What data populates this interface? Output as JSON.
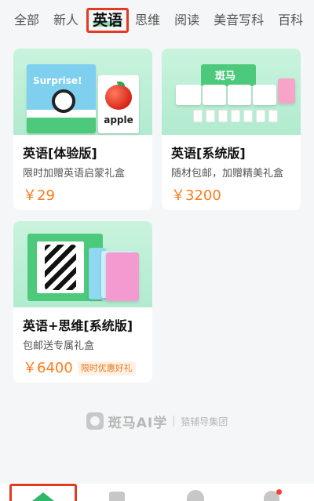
{
  "tabs": [
    {
      "label": "全部"
    },
    {
      "label": "新人"
    },
    {
      "label": "英语",
      "active": true
    },
    {
      "label": "思维"
    },
    {
      "label": "阅读"
    },
    {
      "label": "美音写科"
    },
    {
      "label": "百科"
    }
  ],
  "products": [
    {
      "title": "英语[体验版]",
      "desc": "限时加赠英语启蒙礼盒",
      "price": "￥29",
      "thumb": {
        "book_text": "Surprise!",
        "card_word": "apple"
      }
    },
    {
      "title": "英语[系统版]",
      "desc": "随材包邮，加赠精美礼盒",
      "price": "￥3200",
      "thumb": {
        "box_text": "斑马"
      }
    },
    {
      "title": "英语+思维[系统版]",
      "desc": "包邮送专属礼盒",
      "price": "￥6400",
      "badge": "限时优惠好礼"
    }
  ],
  "brand": {
    "name": "斑马AI学",
    "group": "猿辅导集团"
  },
  "colors": {
    "accent": "#ff7a1a",
    "highlight_box": "#e23b22",
    "thumb_bg": "#c9f3dd",
    "brand_green": "#4cc97a"
  },
  "bottom_nav": [
    {
      "icon": "home-icon",
      "active": true
    },
    {
      "icon": "book-icon"
    },
    {
      "icon": "chat-icon"
    },
    {
      "icon": "profile-icon"
    }
  ]
}
